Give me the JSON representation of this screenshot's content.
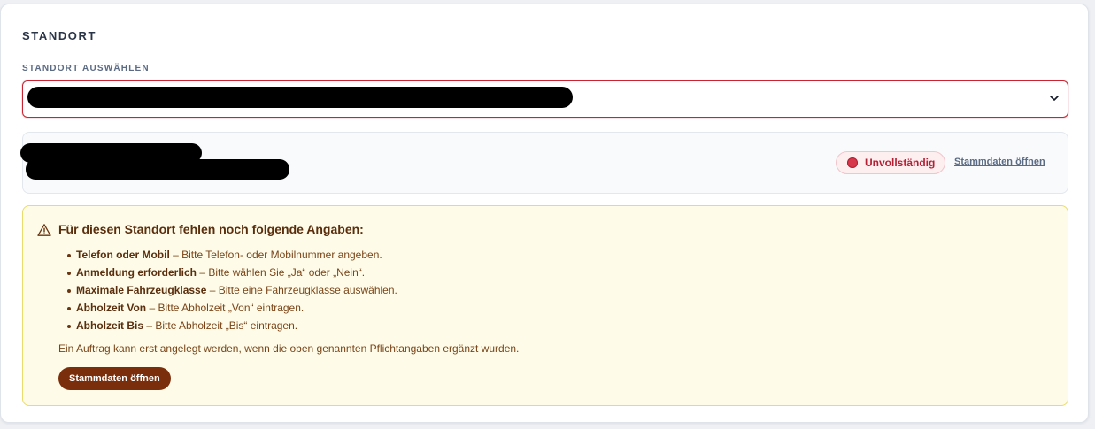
{
  "section": {
    "title": "STANDORT",
    "select_label": "STANDORT AUSWÄHLEN",
    "select_value": ""
  },
  "location": {
    "name": "",
    "address": "",
    "status_badge": "Unvollständig",
    "open_link": "Stammdaten öffnen"
  },
  "colors": {
    "error": "#c9242f",
    "warning_bg": "#fefce8",
    "warning_border": "#eadb6c",
    "button_bg": "#7a2e0b"
  },
  "icons": {
    "select_chevron": "chevron-down-icon",
    "warning": "warning-triangle-icon",
    "status": "status-dot-icon"
  },
  "warning": {
    "title": "Für diesen Standort fehlen noch folgende Angaben:",
    "items": [
      {
        "title": "Telefon oder Mobil",
        "desc": " – Bitte Telefon- oder Mobilnummer angeben."
      },
      {
        "title": "Anmeldung erforderlich",
        "desc": " – Bitte wählen Sie „Ja“ oder „Nein“."
      },
      {
        "title": "Maximale Fahrzeugklasse",
        "desc": " – Bitte eine Fahrzeugklasse auswählen."
      },
      {
        "title": "Abholzeit Von",
        "desc": " – Bitte Abholzeit „Von“ eintragen."
      },
      {
        "title": "Abholzeit Bis",
        "desc": " – Bitte Abholzeit „Bis“ eintragen."
      }
    ],
    "note": "Ein Auftrag kann erst angelegt werden, wenn die oben genannten Pflichtangaben ergänzt wurden.",
    "button_label": "Stammdaten öffnen"
  }
}
